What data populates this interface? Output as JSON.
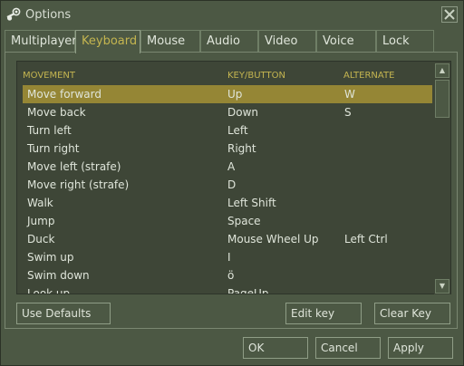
{
  "window": {
    "title": "Options",
    "close_glyph": "✕"
  },
  "tabs": [
    "Multiplayer",
    "Keyboard",
    "Mouse",
    "Audio",
    "Video",
    "Voice",
    "Lock"
  ],
  "active_tab": "Keyboard",
  "columns": {
    "action": "MOVEMENT",
    "key": "KEY/BUTTON",
    "alternate": "ALTERNATE"
  },
  "rows": [
    {
      "action": "Move forward",
      "key": "Up",
      "alternate": "W"
    },
    {
      "action": "Move back",
      "key": "Down",
      "alternate": "S"
    },
    {
      "action": "Turn left",
      "key": "Left",
      "alternate": ""
    },
    {
      "action": "Turn right",
      "key": "Right",
      "alternate": ""
    },
    {
      "action": "Move left (strafe)",
      "key": "A",
      "alternate": ""
    },
    {
      "action": "Move right (strafe)",
      "key": "D",
      "alternate": ""
    },
    {
      "action": "Walk",
      "key": "Left Shift",
      "alternate": ""
    },
    {
      "action": "Jump",
      "key": "Space",
      "alternate": ""
    },
    {
      "action": "Duck",
      "key": "Mouse Wheel Up",
      "alternate": "Left Ctrl"
    },
    {
      "action": "Swim up",
      "key": "I",
      "alternate": ""
    },
    {
      "action": "Swim down",
      "key": "ö",
      "alternate": ""
    },
    {
      "action": "Look up",
      "key": "PageUp",
      "alternate": ""
    }
  ],
  "selected_row": 0,
  "buttons": {
    "use_defaults": "Use Defaults",
    "edit_key": "Edit key",
    "clear_key": "Clear Key",
    "ok": "OK",
    "cancel": "Cancel",
    "apply": "Apply"
  },
  "colors": {
    "accent": "#c4b550",
    "selection": "#958635",
    "background": "#4c5844"
  },
  "icons": {
    "app": "steam-icon",
    "close": "close-icon",
    "scroll_up": "arrow-up-icon",
    "scroll_down": "arrow-down-icon"
  }
}
